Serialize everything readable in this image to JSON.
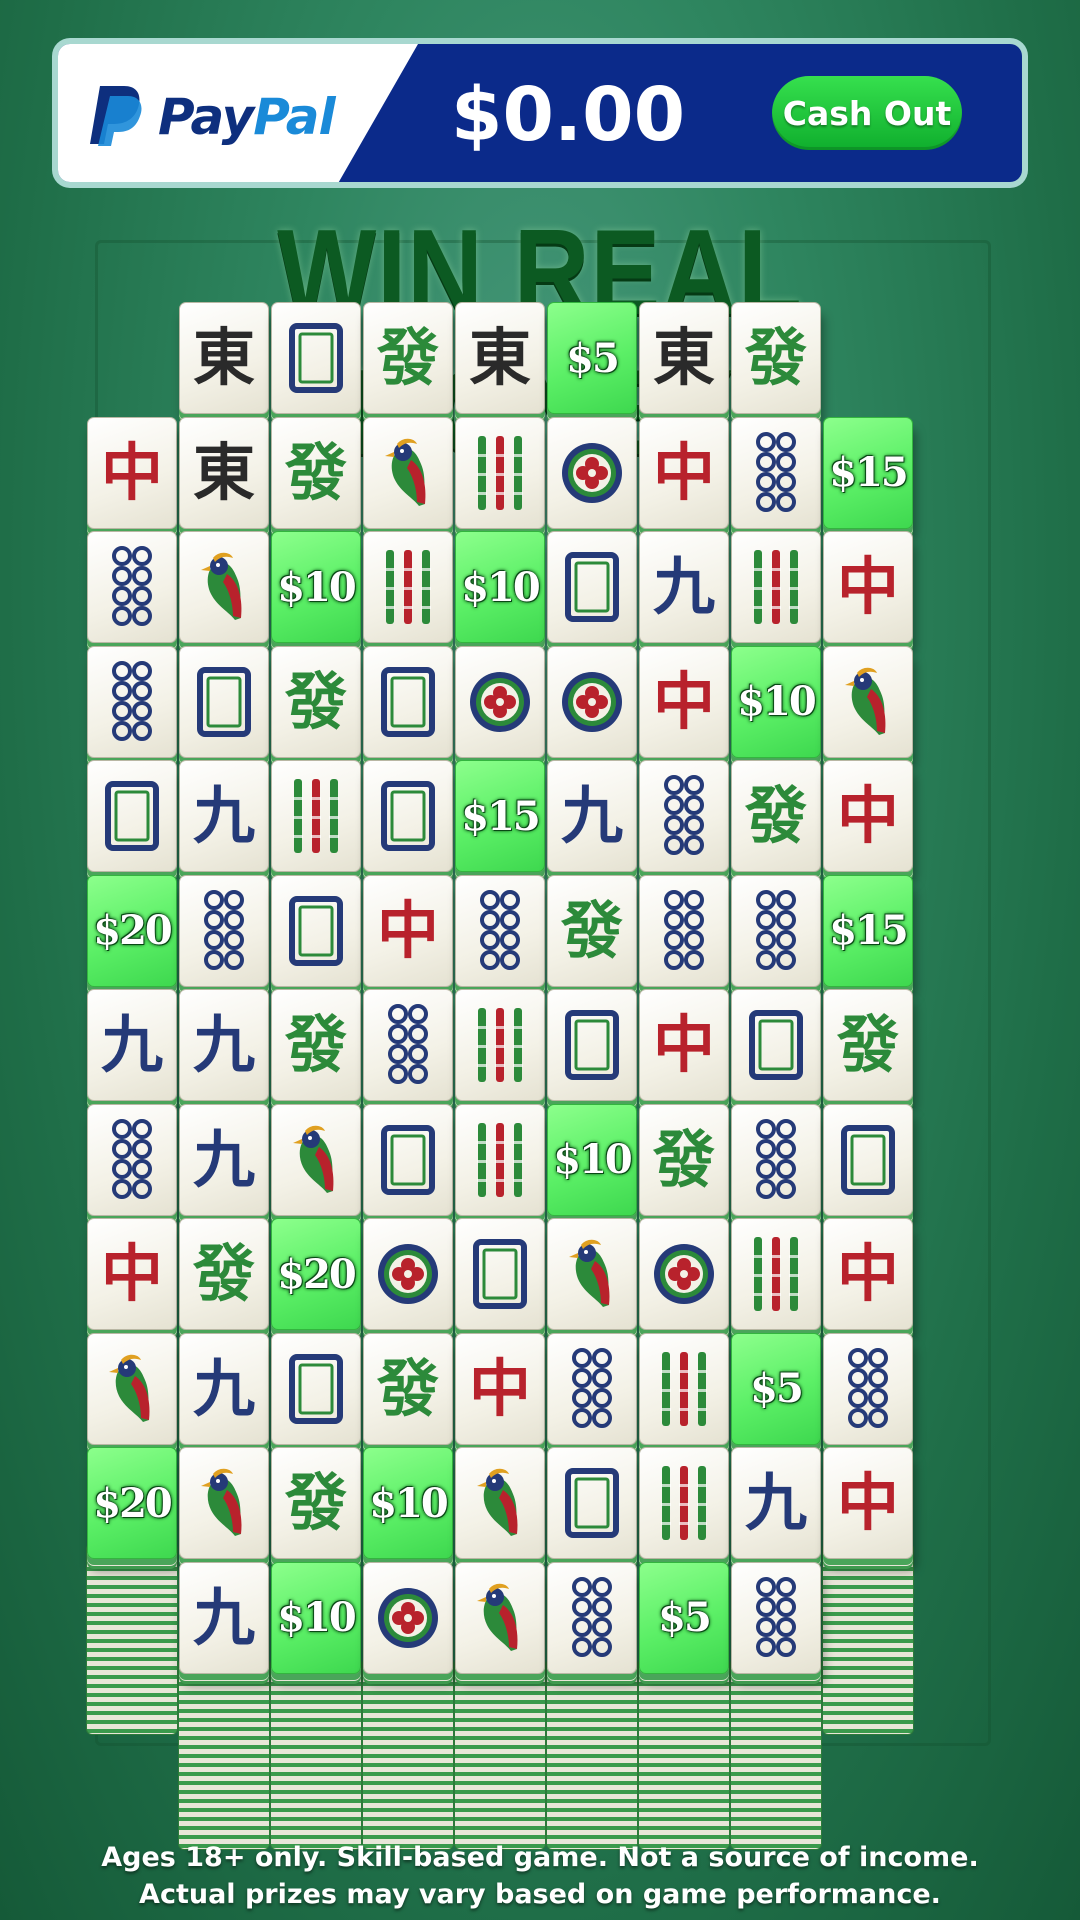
{
  "header": {
    "brand_pay": "Pay",
    "brand_pal": "Pal",
    "logo_icon": "paypal-p-icon",
    "balance": "$0.00",
    "cash_out_label": "Cash Out"
  },
  "headline": "WIN REAL MONEY",
  "colors": {
    "paypal_navy": "#0b2a8a",
    "cashout_green": "#1ec23a",
    "tile_money_green": "#5bef66",
    "headline_green": "#0c5a22"
  },
  "tile_types": {
    "E": {
      "name": "east-wind-tile",
      "glyph": "東"
    },
    "R": {
      "name": "red-dragon-tile",
      "glyph": "中"
    },
    "G": {
      "name": "green-dragon-tile",
      "glyph": "發"
    },
    "W": {
      "name": "white-dragon-tile",
      "icon": "white-dragon-frame-icon"
    },
    "N": {
      "name": "nine-character-tile",
      "glyph": "九"
    },
    "B": {
      "name": "bird-tile",
      "icon": "bird-icon"
    },
    "S": {
      "name": "bamboo-tile",
      "icon": "bamboo-sticks-icon"
    },
    "C": {
      "name": "circle-tile",
      "icon": "flower-circle-icon"
    },
    "D": {
      "name": "dots-tile",
      "icon": "eight-dots-icon"
    }
  },
  "board": {
    "rows": [
      [
        "",
        "E",
        "W",
        "G",
        "E",
        "$5",
        "E",
        "G",
        ""
      ],
      [
        "R",
        "E",
        "G",
        "B",
        "S",
        "C",
        "R",
        "D",
        "$15"
      ],
      [
        "D",
        "B",
        "$10",
        "S",
        "$10",
        "W",
        "N",
        "S",
        "R"
      ],
      [
        "D",
        "W",
        "G",
        "W",
        "C",
        "C",
        "R",
        "$10",
        "B"
      ],
      [
        "W",
        "N",
        "S",
        "W",
        "$15",
        "N",
        "D",
        "G",
        "R"
      ],
      [
        "$20",
        "D",
        "W",
        "R",
        "D",
        "G",
        "D",
        "D",
        "$15"
      ],
      [
        "N",
        "N",
        "G",
        "D",
        "S",
        "W",
        "R",
        "W",
        "G"
      ],
      [
        "D",
        "N",
        "B",
        "W",
        "S",
        "$10",
        "G",
        "D",
        "W"
      ],
      [
        "R",
        "G",
        "$20",
        "C",
        "W",
        "B",
        "C",
        "S",
        "R"
      ],
      [
        "B",
        "N",
        "W",
        "G",
        "R",
        "D",
        "S",
        "$5",
        "D"
      ],
      [
        "$20",
        "B",
        "G",
        "$10",
        "B",
        "W",
        "S",
        "N",
        "R"
      ],
      [
        "",
        "N",
        "$10",
        "C",
        "B",
        "D",
        "$5",
        "D",
        ""
      ]
    ]
  },
  "disclaimer": {
    "line1": "Ages 18+ only. Skill-based game. Not a source of income.",
    "line2": "Actual prizes may vary based on game performance."
  }
}
